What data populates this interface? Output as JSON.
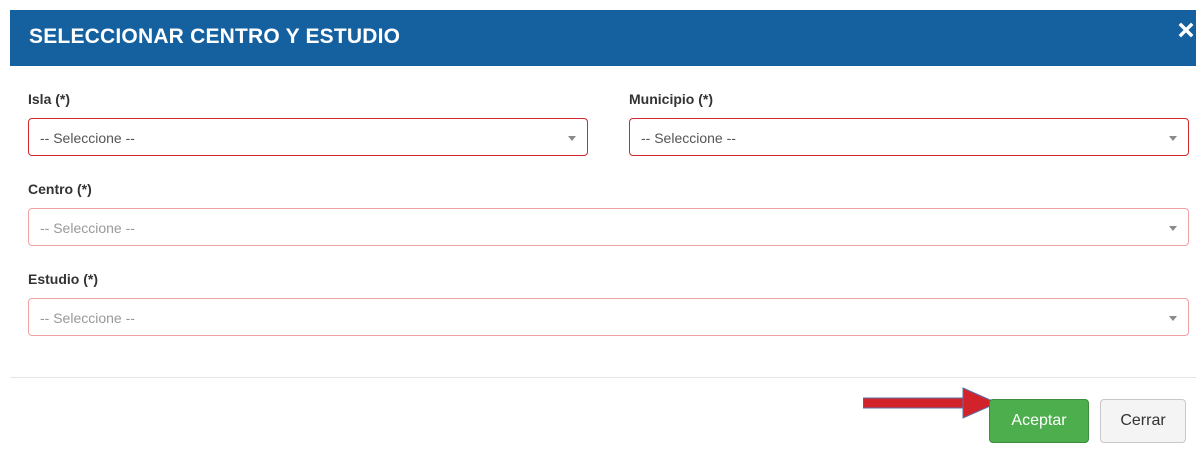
{
  "dialog": {
    "title": "SELECCIONAR CENTRO Y ESTUDIO",
    "close_icon": "close-icon",
    "header_color": "#15609e"
  },
  "fields": {
    "isla": {
      "label": "Isla (*)",
      "value": "-- Seleccione --"
    },
    "municipio": {
      "label": "Municipio (*)",
      "value": "-- Seleccione --"
    },
    "centro": {
      "label": "Centro (*)",
      "placeholder": "-- Seleccione --"
    },
    "estudio": {
      "label": "Estudio (*)",
      "placeholder": "-- Seleccione --"
    }
  },
  "footer": {
    "accept_label": "Aceptar",
    "close_label": "Cerrar",
    "accept_color": "#4cae4c"
  },
  "annotation": {
    "arrow_color": "#d2232a",
    "icon": "red-arrow-icon"
  }
}
